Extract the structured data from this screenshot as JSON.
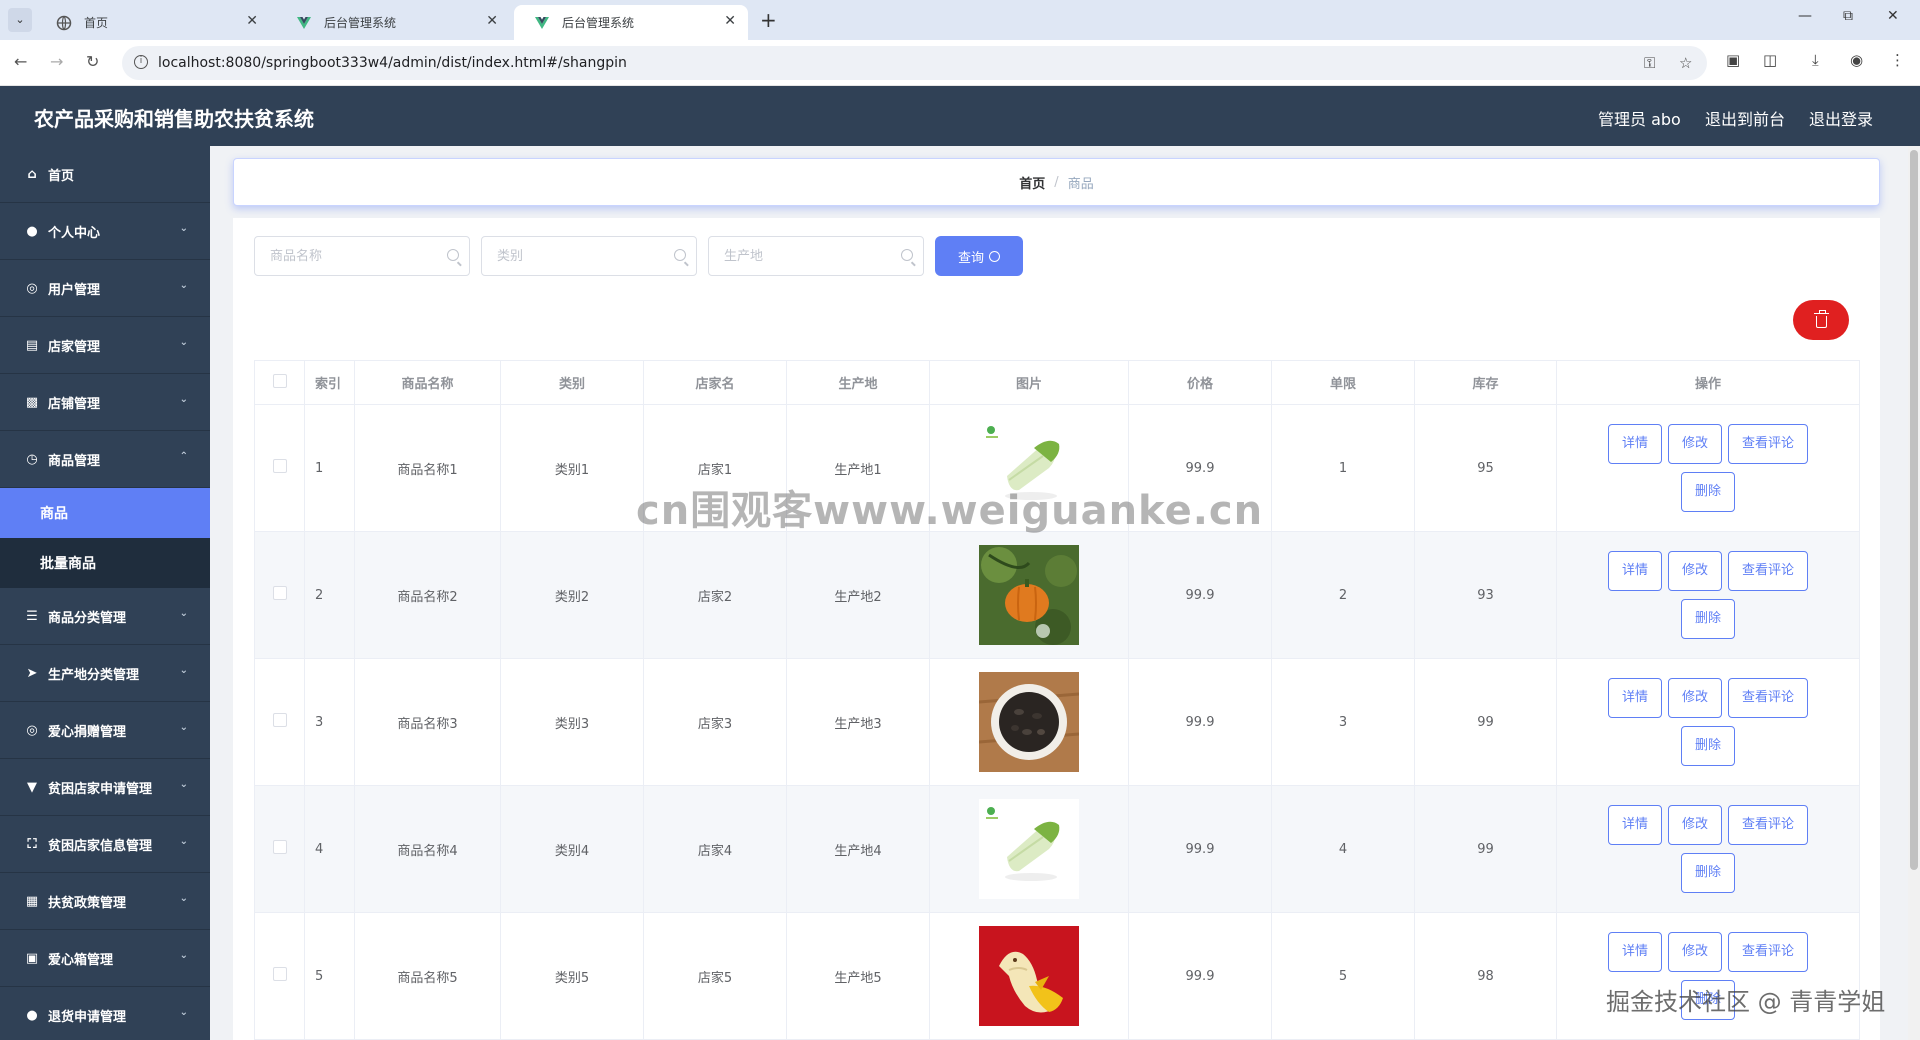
{
  "browser": {
    "tabs": [
      {
        "label": "首页",
        "active": false
      },
      {
        "label": "后台管理系统",
        "active": false
      },
      {
        "label": "后台管理系统",
        "active": true
      }
    ],
    "url": "localhost:8080/springboot333w4/admin/dist/index.html#/shangpin"
  },
  "header": {
    "title": "农产品采购和销售助农扶贫系统",
    "user": "管理员 abo",
    "front_link": "退出到前台",
    "logout_link": "退出登录"
  },
  "sidebar": {
    "items": [
      {
        "label": "首页",
        "icon": "home-icon"
      },
      {
        "label": "个人中心",
        "icon": "user-icon"
      },
      {
        "label": "用户管理",
        "icon": "compass-icon"
      },
      {
        "label": "店家管理",
        "icon": "store-icon"
      },
      {
        "label": "店铺管理",
        "icon": "shop-icon"
      },
      {
        "label": "商品管理",
        "icon": "clock-icon"
      },
      {
        "label": "商品分类管理",
        "icon": "menu-icon"
      },
      {
        "label": "生产地分类管理",
        "icon": "send-icon"
      },
      {
        "label": "爱心捐赠管理",
        "icon": "compass-icon"
      },
      {
        "label": "贫困店家申请管理",
        "icon": "cup-icon"
      },
      {
        "label": "贫困店家信息管理",
        "icon": "fullscreen-icon"
      },
      {
        "label": "扶贫政策管理",
        "icon": "calendar-icon"
      },
      {
        "label": "爱心箱管理",
        "icon": "crop-icon"
      },
      {
        "label": "退货申请管理",
        "icon": "user-icon"
      }
    ],
    "submenu": [
      {
        "label": "商品"
      },
      {
        "label": "批量商品"
      }
    ]
  },
  "breadcrumb": {
    "home": "首页",
    "sep": "/",
    "current": "商品"
  },
  "search": {
    "name_placeholder": "商品名称",
    "category_placeholder": "类别",
    "origin_placeholder": "生产地",
    "query_label": "查询"
  },
  "table": {
    "headers": [
      "索引",
      "商品名称",
      "类别",
      "店家名",
      "生产地",
      "图片",
      "价格",
      "单限",
      "库存",
      "操作"
    ],
    "rows": [
      {
        "index": "1",
        "name": "商品名称1",
        "category": "类别1",
        "shop": "店家1",
        "origin": "生产地1",
        "image": "cabbage",
        "price": "99.9",
        "limit": "1",
        "stock": "95"
      },
      {
        "index": "2",
        "name": "商品名称2",
        "category": "类别2",
        "shop": "店家2",
        "origin": "生产地2",
        "image": "pumpkin",
        "price": "99.9",
        "limit": "2",
        "stock": "93"
      },
      {
        "index": "3",
        "name": "商品名称3",
        "category": "类别3",
        "shop": "店家3",
        "origin": "生产地3",
        "image": "seeds",
        "price": "99.9",
        "limit": "3",
        "stock": "99"
      },
      {
        "index": "4",
        "name": "商品名称4",
        "category": "类别4",
        "shop": "店家4",
        "origin": "生产地4",
        "image": "cabbage",
        "price": "99.9",
        "limit": "4",
        "stock": "99"
      },
      {
        "index": "5",
        "name": "商品名称5",
        "category": "类别5",
        "shop": "店家5",
        "origin": "生产地5",
        "image": "banana",
        "price": "99.9",
        "limit": "5",
        "stock": "98"
      }
    ],
    "actions": {
      "detail": "详情",
      "edit": "修改",
      "comments": "查看评论",
      "delete": "删除"
    }
  },
  "overlay": {
    "watermark": "cn围观客www.weiguanke.cn",
    "credit": "掘金技术社区 @ 青青学姐"
  },
  "colors": {
    "sidebar_bg": "#304156",
    "accent": "#5f7ff5",
    "danger": "#e02020"
  }
}
